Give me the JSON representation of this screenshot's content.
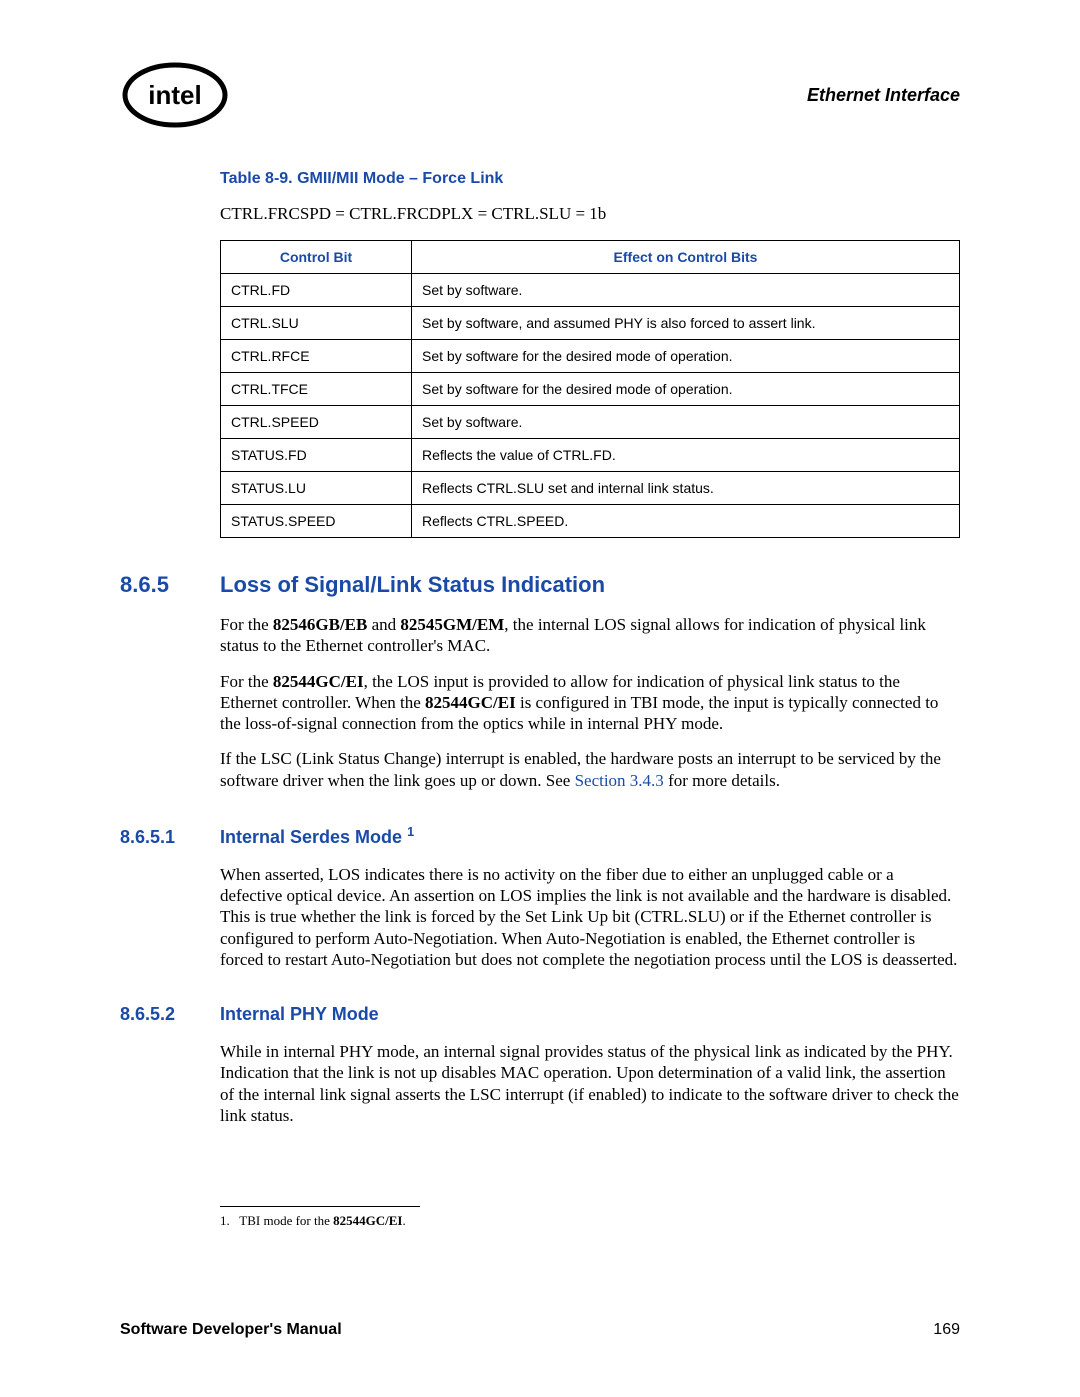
{
  "header": {
    "right": "Ethernet Interface"
  },
  "table": {
    "title": "Table 8-9. GMII/MII Mode – Force Link",
    "pre": "CTRL.FRCSPD = CTRL.FRCDPLX = CTRL.SLU = 1b",
    "headers": {
      "c1": "Control Bit",
      "c2": "Effect on Control Bits"
    },
    "rows": [
      {
        "bit": "CTRL.FD",
        "effect": "Set by software."
      },
      {
        "bit": "CTRL.SLU",
        "effect": "Set by software, and assumed PHY is also forced to assert link."
      },
      {
        "bit": "CTRL.RFCE",
        "effect": "Set by software for the desired mode of operation."
      },
      {
        "bit": "CTRL.TFCE",
        "effect": "Set by software for the desired mode of operation."
      },
      {
        "bit": "CTRL.SPEED",
        "effect": "Set by software."
      },
      {
        "bit": "STATUS.FD",
        "effect": "Reflects the value of CTRL.FD."
      },
      {
        "bit": "STATUS.LU",
        "effect": "Reflects CTRL.SLU set and internal link status."
      },
      {
        "bit": "STATUS.SPEED",
        "effect": "Reflects CTRL.SPEED."
      }
    ]
  },
  "s865": {
    "num": "8.6.5",
    "title": "Loss of Signal/Link Status Indication",
    "p1_a": "For the ",
    "p1_b1": "82546GB/EB",
    "p1_c": " and ",
    "p1_b2": "82545GM/EM",
    "p1_d": ", the internal LOS signal allows for indication of physical link status to the Ethernet controller's MAC.",
    "p2_a": "For the ",
    "p2_b1": "82544GC/EI",
    "p2_c": ", the LOS input is provided to allow for indication of physical link status to the Ethernet controller. When the ",
    "p2_b2": "82544GC/EI",
    "p2_d": " is configured in TBI mode, the input is typically connected to the loss-of-signal connection from the optics while in internal PHY mode.",
    "p3_a": "If the LSC (Link Status Change) interrupt is enabled, the hardware posts an interrupt to be serviced by the software driver when the link goes up or down. See ",
    "p3_link": "Section 3.4.3",
    "p3_b": " for more details."
  },
  "s8651": {
    "num": "8.6.5.1",
    "title": "Internal Serdes Mode ",
    "sup": "1",
    "p1": "When asserted, LOS indicates there is no activity on the fiber due to either an unplugged cable or a defective optical device. An assertion on LOS implies the link is not available and the hardware is disabled. This is true whether the link is forced by the Set Link Up bit (CTRL.SLU) or if the Ethernet controller is configured to perform Auto-Negotiation. When Auto-Negotiation is enabled, the Ethernet controller is forced to restart Auto-Negotiation but does not complete the negotiation process until the LOS is deasserted."
  },
  "s8652": {
    "num": "8.6.5.2",
    "title": "Internal PHY Mode",
    "p1": "While in internal PHY mode, an internal signal provides status of the physical link as indicated by the PHY. Indication that the link is not up disables MAC operation. Upon determination of a valid link, the assertion of the internal link signal asserts the LSC interrupt (if enabled) to indicate to the software driver to check the link status."
  },
  "footnote": {
    "num": "1.",
    "text_a": "TBI mode for the ",
    "text_b": "82544GC/EI",
    "text_c": "."
  },
  "footer": {
    "left": "Software Developer's Manual",
    "right": "169"
  }
}
